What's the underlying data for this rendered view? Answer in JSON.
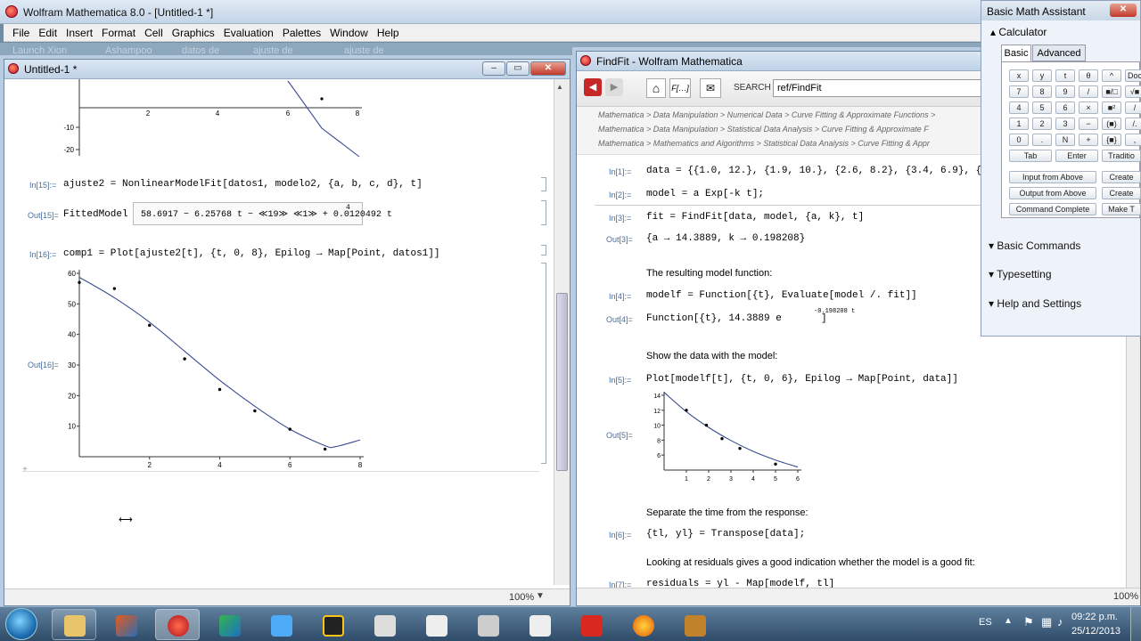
{
  "main_window": {
    "title": "Wolfram Mathematica 8.0 - [Untitled-1 *]"
  },
  "menu": [
    "File",
    "Edit",
    "Insert",
    "Format",
    "Cell",
    "Graphics",
    "Evaluation",
    "Palettes",
    "Window",
    "Help"
  ],
  "desktop_ghost": [
    "Launch Xion",
    "Ashampoo",
    "datos de",
    "ajuste de",
    "ajuste de"
  ],
  "notebook": {
    "title": "Untitled-1 *",
    "zoom": "100%",
    "plot1_yticks": [
      "-10",
      "-20"
    ],
    "plot1_xticks": [
      "2",
      "4",
      "6",
      "8"
    ],
    "in15_label": "In[15]:=",
    "in15_code": "ajuste2 = NonlinearModelFit[datos1, modelo2, {a, b, c, d}, t]",
    "out15_label": "Out[15]=",
    "out15_head": "FittedModel",
    "out15_box": "58.6917 − 6.25768 t − ≪19≫ ≪1≫ + 0.0120492 t",
    "out15_exp": "4",
    "in16_label": "In[16]:=",
    "in16_code": "comp1 = Plot[ajuste2[t], {t, 0, 8}, Epilog → Map[Point, datos1]]",
    "out16_label": "Out[16]="
  },
  "chart_data": [
    {
      "type": "scatter",
      "title": "",
      "xlabel": "",
      "ylabel": "",
      "xlim": [
        0,
        8
      ],
      "ylim": [
        0,
        60
      ],
      "x_ticks": [
        "2",
        "4",
        "6",
        "8"
      ],
      "y_ticks": [
        "10",
        "20",
        "30",
        "40",
        "50",
        "60"
      ],
      "points": [
        [
          0,
          57
        ],
        [
          1,
          55
        ],
        [
          2,
          43
        ],
        [
          3,
          32
        ],
        [
          4,
          22
        ],
        [
          5,
          15
        ],
        [
          6,
          9
        ],
        [
          7,
          2.5
        ]
      ],
      "curve": [
        [
          0,
          58.7
        ],
        [
          1,
          52
        ],
        [
          2,
          44
        ],
        [
          3,
          34.5
        ],
        [
          4,
          25
        ],
        [
          5,
          16.5
        ],
        [
          6,
          9
        ],
        [
          7,
          3.6
        ],
        [
          7.3,
          3.3
        ],
        [
          8,
          5.5
        ]
      ]
    },
    {
      "type": "scatter",
      "title": "",
      "xlabel": "",
      "ylabel": "",
      "xlim": [
        0,
        6
      ],
      "ylim": [
        4,
        14
      ],
      "x_ticks": [
        "1",
        "2",
        "3",
        "4",
        "5",
        "6"
      ],
      "y_ticks": [
        "6",
        "8",
        "10",
        "12",
        "14"
      ],
      "points": [
        [
          1,
          12
        ],
        [
          1.9,
          10
        ],
        [
          2.6,
          8.2
        ],
        [
          3.4,
          6.9
        ],
        [
          5,
          4.8
        ]
      ],
      "curve": [
        [
          0,
          14.39
        ],
        [
          1,
          11.8
        ],
        [
          2,
          9.7
        ],
        [
          3,
          7.95
        ],
        [
          4,
          6.5
        ],
        [
          5,
          5.34
        ],
        [
          6,
          4.4
        ]
      ]
    }
  ],
  "findfit": {
    "title": "FindFit - Wolfram Mathematica",
    "search_label": "SEARCH",
    "search_value": "ref/FindFit",
    "breadcrumbs": [
      "Mathematica > Data Manipulation > Numerical Data > Curve Fitting & Approximate Functions >",
      "Mathematica > Data Manipulation > Statistical Data Analysis > Curve Fitting & Approximate F",
      "Mathematica > Mathematics and Algorithms > Statistical Data Analysis > Curve Fitting & Appr"
    ],
    "in1": "In[1]:=",
    "in1_code": "data = {{1.0, 12.}, {1.9, 10.}, {2.6, 8.2}, {3.4, 6.9}, {5.0,",
    "in2": "In[2]:=",
    "in2_code": "model = a Exp[-k t];",
    "in3": "In[3]:=",
    "in3_code": "fit = FindFit[data, model, {a, k}, t]",
    "out3": "Out[3]=",
    "out3_val": "{a → 14.3889, k → 0.198208}",
    "text1": "The resulting model function:",
    "in4": "In[4]:=",
    "in4_code": "modelf = Function[{t}, Evaluate[model /. fit]]",
    "out4": "Out[4]=",
    "out4_val": "Function[{t}, 14.3889 e",
    "out4_exp": "-0.198208 t",
    "out4_end": "]",
    "text2": "Show the data with the model:",
    "in5": "In[5]:=",
    "in5_code": "Plot[modelf[t], {t, 0, 6}, Epilog → Map[Point, data]]",
    "out5": "Out[5]=",
    "text3": "Separate the time from the response:",
    "in6": "In[6]:=",
    "in6_code": "{tl, yl} = Transpose[data];",
    "text4": "Looking at residuals gives a good indication whether the model is a good fit:",
    "in7": "In[7]:=",
    "in7_code": "residuals = yl - Map[modelf, tl]",
    "zoom": "100%"
  },
  "assistant": {
    "title": "Basic Math Assistant",
    "calculator": "Calculator",
    "tab_basic": "Basic",
    "tab_advanced": "Advanced",
    "keys": [
      [
        "□",
        "x",
        "y",
        "t",
        "θ",
        "^",
        "Doc"
      ],
      [
        "7",
        "8",
        "9",
        "/",
        "■/□",
        "√■"
      ],
      [
        "4",
        "5",
        "6",
        "×",
        "■²",
        "/"
      ],
      [
        "1",
        "2",
        "3",
        "−",
        "(■)",
        "/."
      ],
      [
        "0",
        ".",
        "N",
        "+",
        "{■}",
        ","
      ]
    ],
    "tab": "Tab",
    "enter": "Enter",
    "tradition": "Traditio",
    "input_above": "Input from Above",
    "output_above": "Output from Above",
    "command_complete": "Command Complete",
    "create": "Create",
    "make": "Make T",
    "sections": [
      "Basic Commands",
      "Typesetting",
      "Help and Settings"
    ]
  },
  "tray": {
    "lang": "ES",
    "time": "09:22 p.m.",
    "date": "25/12/2013"
  }
}
